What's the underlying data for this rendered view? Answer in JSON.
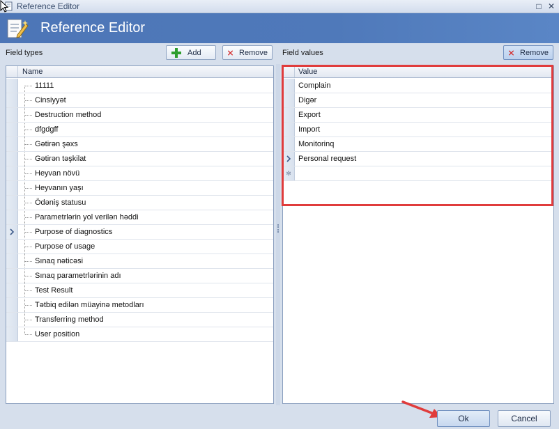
{
  "window": {
    "title": "Reference Editor",
    "maximize_glyph": "□",
    "close_glyph": "✕"
  },
  "banner": {
    "title": "Reference Editor",
    "icon": "edit-document-icon"
  },
  "left_panel": {
    "label": "Field types",
    "add_label": "Add",
    "remove_label": "Remove",
    "column_header": "Name",
    "current_row_index": 10,
    "items": [
      "11111",
      "Cinsiyyət",
      "Destruction method",
      "dfgdgff",
      "Gətirən şəxs",
      "Gətirən təşkilat",
      "Heyvan növü",
      "Heyvanın yaşı",
      "Ödəniş statusu",
      "Parametrlərin yol verilən həddi",
      "Purpose of diagnostics",
      "Purpose of usage",
      "Sınaq nəticəsi",
      "Sınaq parametrlərinin adı",
      "Test Result",
      "Tətbiq edilən müayinə metodları",
      "Transferring method",
      "User position"
    ]
  },
  "right_panel": {
    "label": "Field values",
    "remove_label": "Remove",
    "column_header": "Value",
    "current_row_index": 5,
    "new_row_glyph": "✻",
    "items": [
      "Complain",
      "Digər",
      "Export",
      "Import",
      "Monitorinq",
      "Personal request"
    ]
  },
  "footer": {
    "ok_label": "Ok",
    "cancel_label": "Cancel"
  },
  "colors": {
    "banner": "#4f79ba",
    "highlight": "#e03c3c",
    "add_icon": "#2e9e2e",
    "remove_icon": "#d42828"
  }
}
